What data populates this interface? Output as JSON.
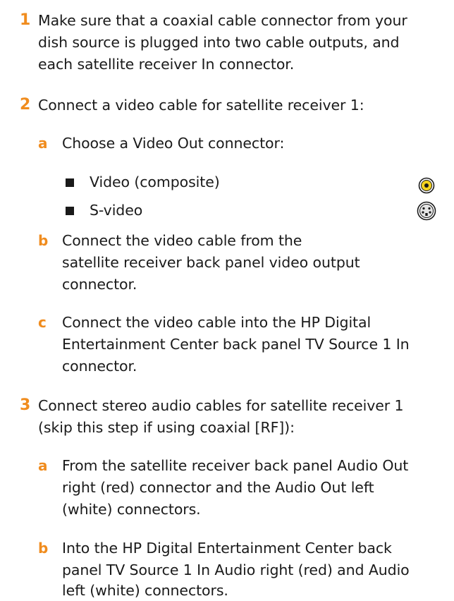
{
  "steps": [
    {
      "number": "1",
      "lines": [
        "Make sure that a coaxial cable connector from your",
        "dish source is plugged into two cable outputs, and",
        "each satellite receiver In connector."
      ]
    },
    {
      "number": "2",
      "lines": [
        "Connect a video cable for satellite receiver 1:"
      ],
      "substeps": [
        {
          "letter": "a",
          "lines": [
            "Choose a Video Out connector:"
          ],
          "bullets": [
            "Video (composite)",
            "S-video"
          ]
        },
        {
          "letter": "b",
          "lines": [
            "Connect the video cable from the",
            "satellite receiver back panel video output",
            "connector."
          ]
        },
        {
          "letter": "c",
          "lines": [
            "Connect the video cable into the HP Digital",
            "Entertainment Center back panel TV Source 1 In",
            "connector."
          ]
        }
      ]
    },
    {
      "number": "3",
      "lines": [
        "Connect stereo audio cables for satellite receiver 1",
        "(skip this step if using coaxial [RF]):"
      ],
      "substeps": [
        {
          "letter": "a",
          "lines": [
            "From the satellite receiver back panel Audio Out",
            "right (red) connector and the Audio Out left",
            "(white) connectors."
          ]
        },
        {
          "letter": "b",
          "lines": [
            "Into the HP Digital Entertainment Center back",
            "panel TV Source 1 In Audio right (red) and Audio",
            "left (white) connectors."
          ]
        }
      ]
    }
  ],
  "icons": {
    "composite": "composite-video-connector-icon",
    "svideo": "s-video-connector-icon"
  },
  "colors": {
    "accent": "#f08c1e",
    "text": "#1a1a1a",
    "composite_yellow": "#f5d21e"
  }
}
